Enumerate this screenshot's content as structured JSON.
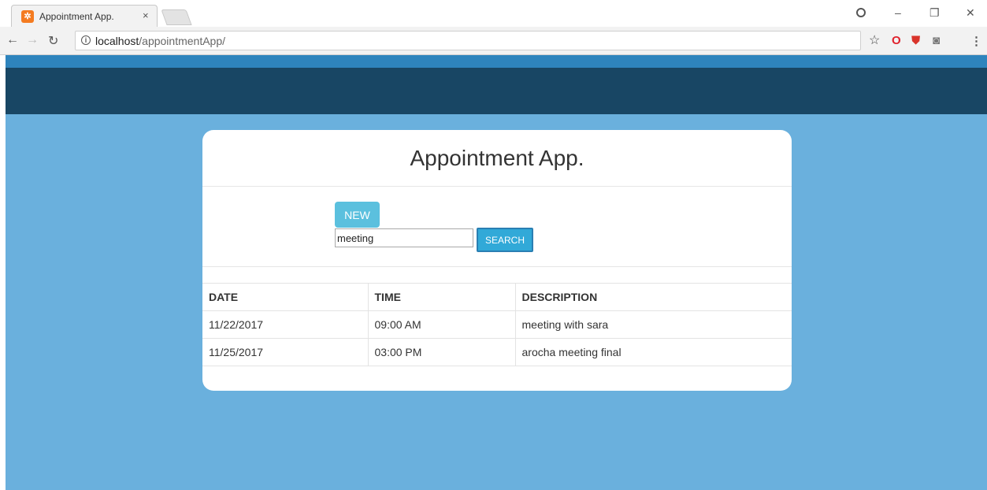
{
  "browser": {
    "tab_title": "Appointment App.",
    "tab_close": "×",
    "url_host": "localhost",
    "url_path": "/appointmentApp/"
  },
  "app": {
    "title": "Appointment App.",
    "new_label": "NEW",
    "search_value": "meeting",
    "search_label": "SEARCH"
  },
  "table": {
    "headers": [
      "DATE",
      "TIME",
      "DESCRIPTION"
    ],
    "rows": [
      [
        "11/22/2017",
        "09:00 AM",
        "meeting with sara"
      ],
      [
        "11/25/2017",
        "03:00 PM",
        "arocha meeting final"
      ]
    ]
  },
  "colors": {
    "page_bg": "#6ab0dd",
    "nav_dark": "#184664",
    "nav_top": "#2e84bd",
    "new_button": "#5bc0de",
    "search_button": "#31a9d8"
  },
  "icons": {
    "tab_favicon": "xampp-icon",
    "info": "info-icon",
    "star": "star-icon",
    "opera": "opera-icon",
    "shield": "shield-icon",
    "extension": "extension-icon",
    "menu": "kebab-menu-icon"
  }
}
